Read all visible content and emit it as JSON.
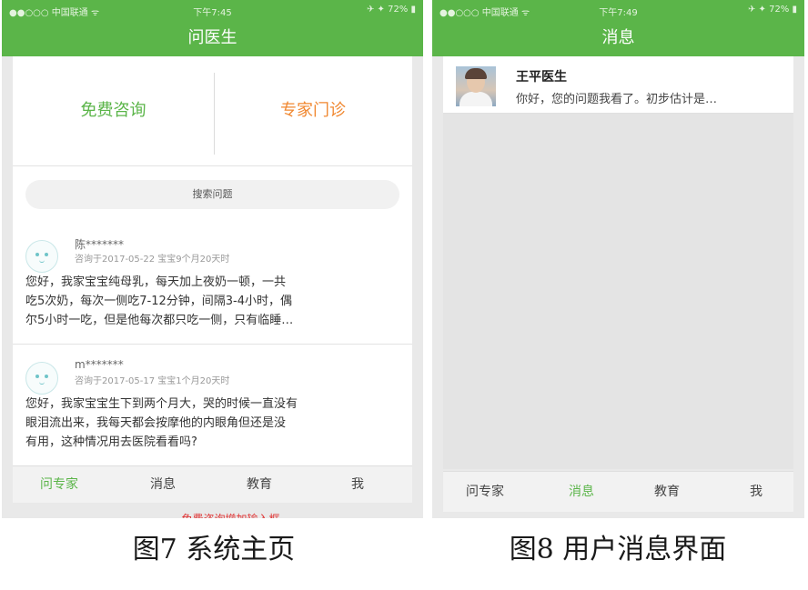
{
  "left_phone": {
    "status": {
      "left": "●●○○○ 中国联通 ᯤ",
      "time": "下午7:45",
      "right": "✈ ✦ 72% ▮"
    },
    "title": "问医生",
    "free_consult": "免费咨询",
    "expert_clinic": "专家门诊",
    "search_placeholder": "搜索问题",
    "posts": [
      {
        "user": "陈*******",
        "meta": "咨询于2017-05-22 宝宝9个月20天时",
        "lines": [
          "您好，我家宝宝纯母乳，每天加上夜奶一顿，一共",
          "吃5次奶，每次一侧吃7-12分钟，间隔3-4小时，偶",
          "尔5小时一吃，但是他每次都只吃一侧，只有临睡…"
        ]
      },
      {
        "user": "m*******",
        "meta": "咨询于2017-05-17 宝宝1个月20天时",
        "lines": [
          "您好，我家宝宝生下到两个月大，哭的时候一直没有",
          "眼泪流出来，我每天都会按摩他的内眼角但还是没",
          "有用，这种情况用去医院看看吗?"
        ]
      }
    ],
    "tabs": [
      "问专家",
      "消息",
      "教育",
      "我"
    ],
    "overflow_text": "免费咨询增加输入框"
  },
  "right_phone": {
    "status": {
      "left": "●●○○○ 中国联通 ᯤ",
      "time": "下午7:49",
      "right": "✈ ✦ 72% ▮"
    },
    "title": "消息",
    "message": {
      "doctor_name": "王平医生",
      "preview": "你好，您的问题我看了。初步估计是…"
    },
    "tabs": [
      "问专家",
      "消息",
      "教育",
      "我"
    ]
  },
  "captions": {
    "left": "图7  系统主页",
    "right": "图8  用户消息界面"
  },
  "colors": {
    "brand_green": "#5bb549",
    "accent_orange": "#f0872f",
    "alert_red": "#e03636"
  }
}
